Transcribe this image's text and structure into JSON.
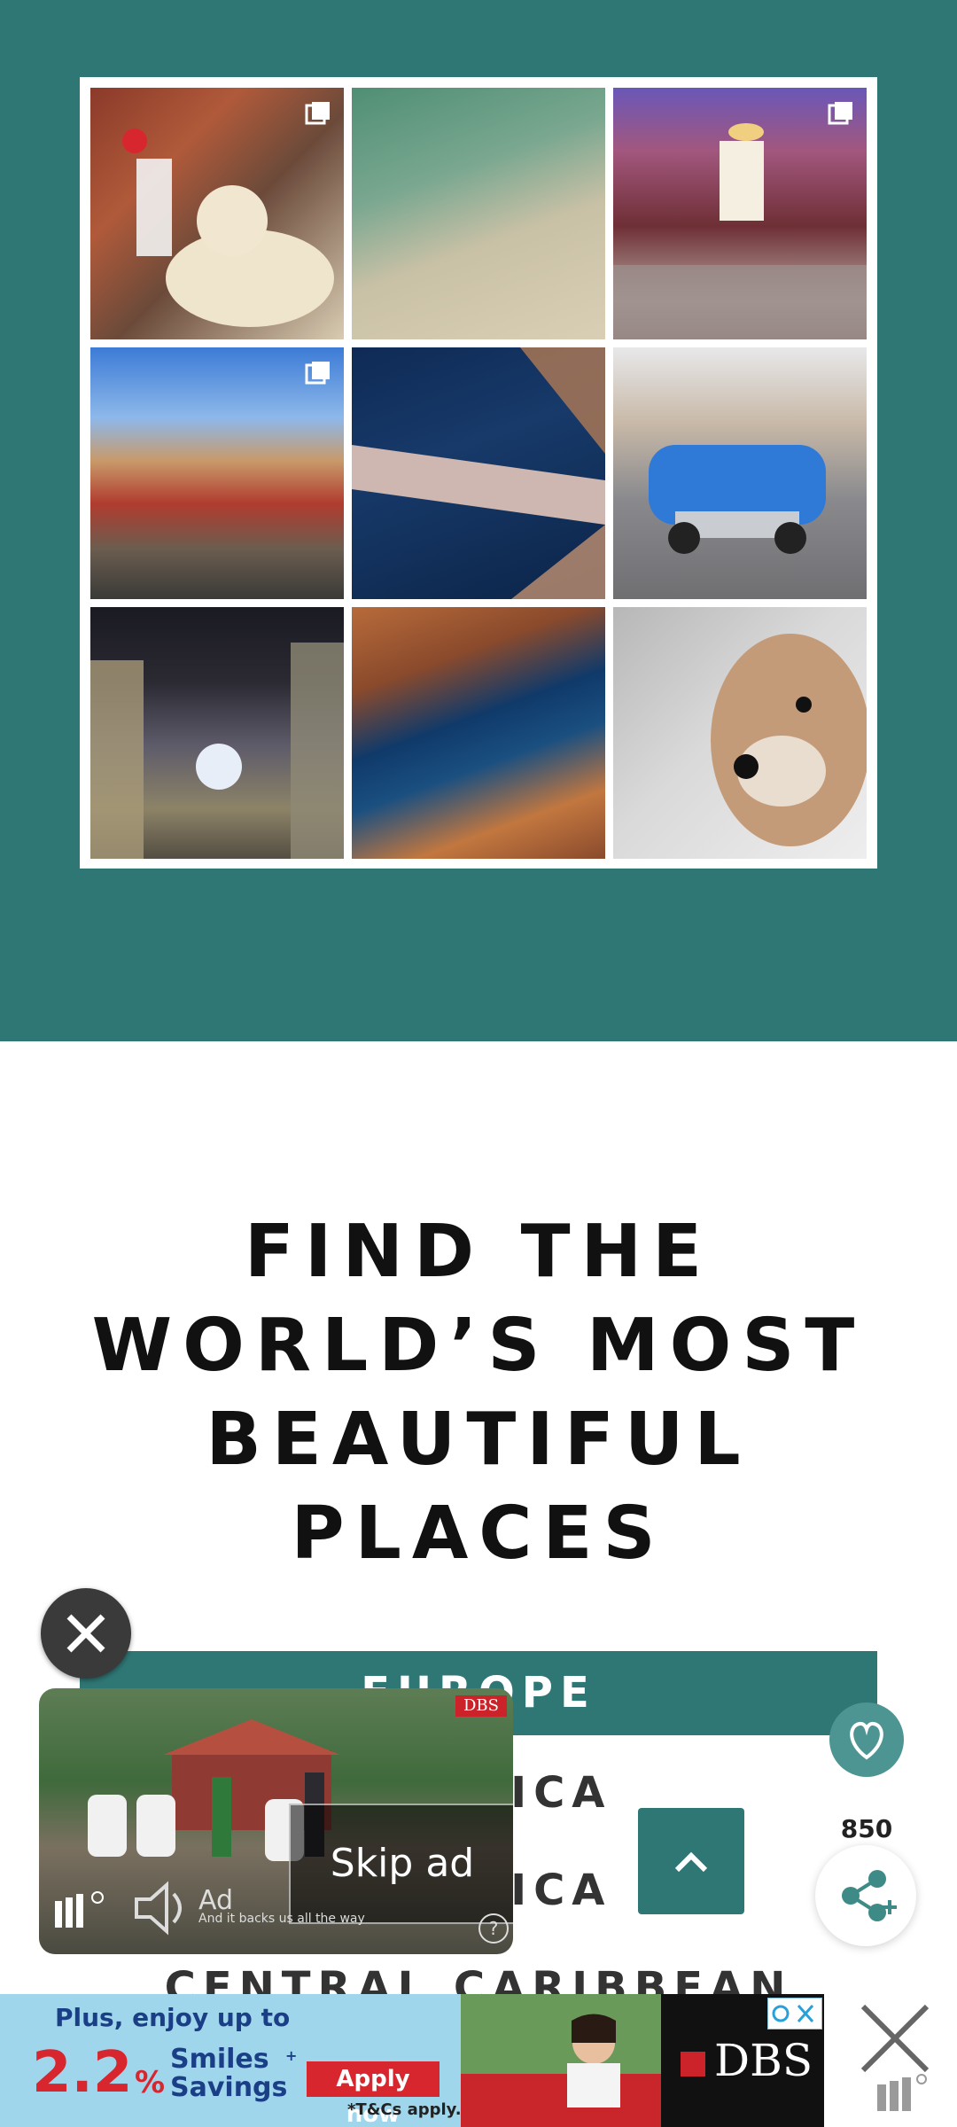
{
  "headline": "FIND THE WORLD'S MOST BEAUTIFUL PLACES",
  "headline_lines": [
    "FIND THE",
    "WORLD’S MOST",
    "BEAUTIFUL",
    "PLACES"
  ],
  "regions": [
    "EUROPE",
    "AMERICA",
    "AMERICA",
    "CENTRAL CARIBBEAN"
  ],
  "colors": {
    "brand_teal": "#2f7775",
    "accent_red": "#d8262e",
    "ad_blue": "#9fd6ec"
  },
  "instagram_grid": {
    "tiles": [
      "dog-with-carousel-horse",
      "aerial-sandbank",
      "pub-interior",
      "colorful-riverside-houses",
      "aerial-river-bridge",
      "blue-vintage-car",
      "night-street-lights",
      "aerial-lake-forest",
      "husky-puppy"
    ]
  },
  "video_ad": {
    "skip_label": "Skip ad",
    "ad_label": "Ad",
    "ad_caption": "And it backs us all the way",
    "brand": "DBS",
    "help_icon": "question-icon",
    "mute_icon": "speaker-muted-icon"
  },
  "floating": {
    "share_count": "850",
    "heart_icon": "heart-icon",
    "share_icon": "share-icon",
    "up_icon": "chevron-up-icon"
  },
  "banner_ad": {
    "line1": "Plus, enjoy up to",
    "rate": "2.2",
    "percent": "%",
    "smiles": "Smiles",
    "savings": "Savings",
    "registered": "+",
    "cta": "Apply now",
    "tnc": "*T&Cs apply.",
    "brand": "DBS"
  }
}
